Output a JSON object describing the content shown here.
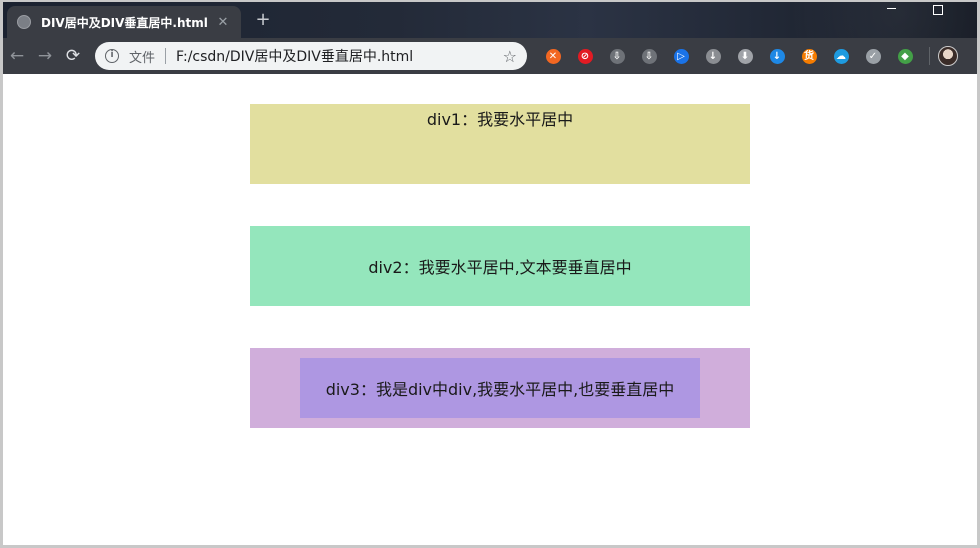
{
  "browser": {
    "tab": {
      "title": "DIV居中及DIV垂直居中.html",
      "close": "✕"
    },
    "new_tab": "+",
    "omnibox": {
      "security_label": "文件",
      "url": "F:/csdn/DIV居中及DIV垂直居中.html"
    },
    "extensions": [
      {
        "name": "ext-orange-circle",
        "color": "#f26722",
        "glyph": "✕"
      },
      {
        "name": "ext-red-circle",
        "color": "#e21b23",
        "glyph": "⊘"
      },
      {
        "name": "ext-down-arrow-gray",
        "color": "#6e7278",
        "glyph": "⇩"
      },
      {
        "name": "ext-down-arrow-gray-2",
        "color": "#6e7278",
        "glyph": "⇩"
      },
      {
        "name": "ext-play-blue",
        "color": "#1a73e8",
        "glyph": "▷"
      },
      {
        "name": "ext-download-circle",
        "color": "#8a8d92",
        "glyph": "↓"
      },
      {
        "name": "ext-download-box",
        "color": "#a0a3a8",
        "glyph": "⬇"
      },
      {
        "name": "ext-download-blue",
        "color": "#1e88e5",
        "glyph": "↓"
      },
      {
        "name": "ext-huo-orange",
        "color": "#f57c00",
        "glyph": "货"
      },
      {
        "name": "ext-cloud",
        "color": "#1e9be0",
        "glyph": "☁"
      },
      {
        "name": "ext-shield",
        "color": "#9aa0a6",
        "glyph": "✓"
      },
      {
        "name": "ext-colorful",
        "color": "#43a047",
        "glyph": "◆"
      }
    ]
  },
  "page": {
    "div1": "div1：我要水平居中",
    "div2": "div2：我要水平居中,文本要垂直居中",
    "div3": "div3：我是div中div,我要水平居中,也要垂直居中"
  },
  "colors": {
    "div1": "#e2df9f",
    "div2": "#94e6bc",
    "div3_outer": "#d0aedb",
    "div3_inner": "#ae97e2"
  }
}
